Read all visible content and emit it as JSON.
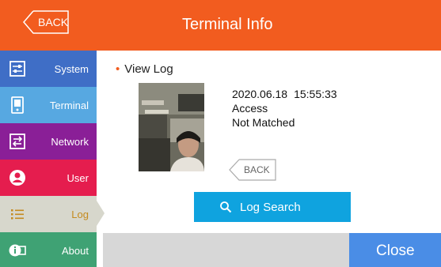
{
  "header": {
    "back_label": "BACK",
    "title": "Terminal Info",
    "color": "#f25c1f"
  },
  "sidebar": {
    "items": [
      {
        "label": "System",
        "icon": "system-icon",
        "color": "#3f6ec6"
      },
      {
        "label": "Terminal",
        "icon": "terminal-icon",
        "color": "#57a8e1"
      },
      {
        "label": "Network",
        "icon": "network-icon",
        "color": "#8a1f97"
      },
      {
        "label": "User",
        "icon": "user-icon",
        "color": "#e51d4e"
      },
      {
        "label": "Log",
        "icon": "log-icon",
        "color": "#d7d7cc",
        "selected": true
      },
      {
        "label": "About",
        "icon": "info-icon",
        "color": "#3fa274"
      }
    ]
  },
  "main": {
    "section_title": "View Log",
    "log": {
      "date": "2020.06.18",
      "time": "15:55:33",
      "type": "Access",
      "result": "Not Matched"
    },
    "back_label": "BACK",
    "search_label": "Log Search"
  },
  "footer": {
    "close_label": "Close"
  }
}
